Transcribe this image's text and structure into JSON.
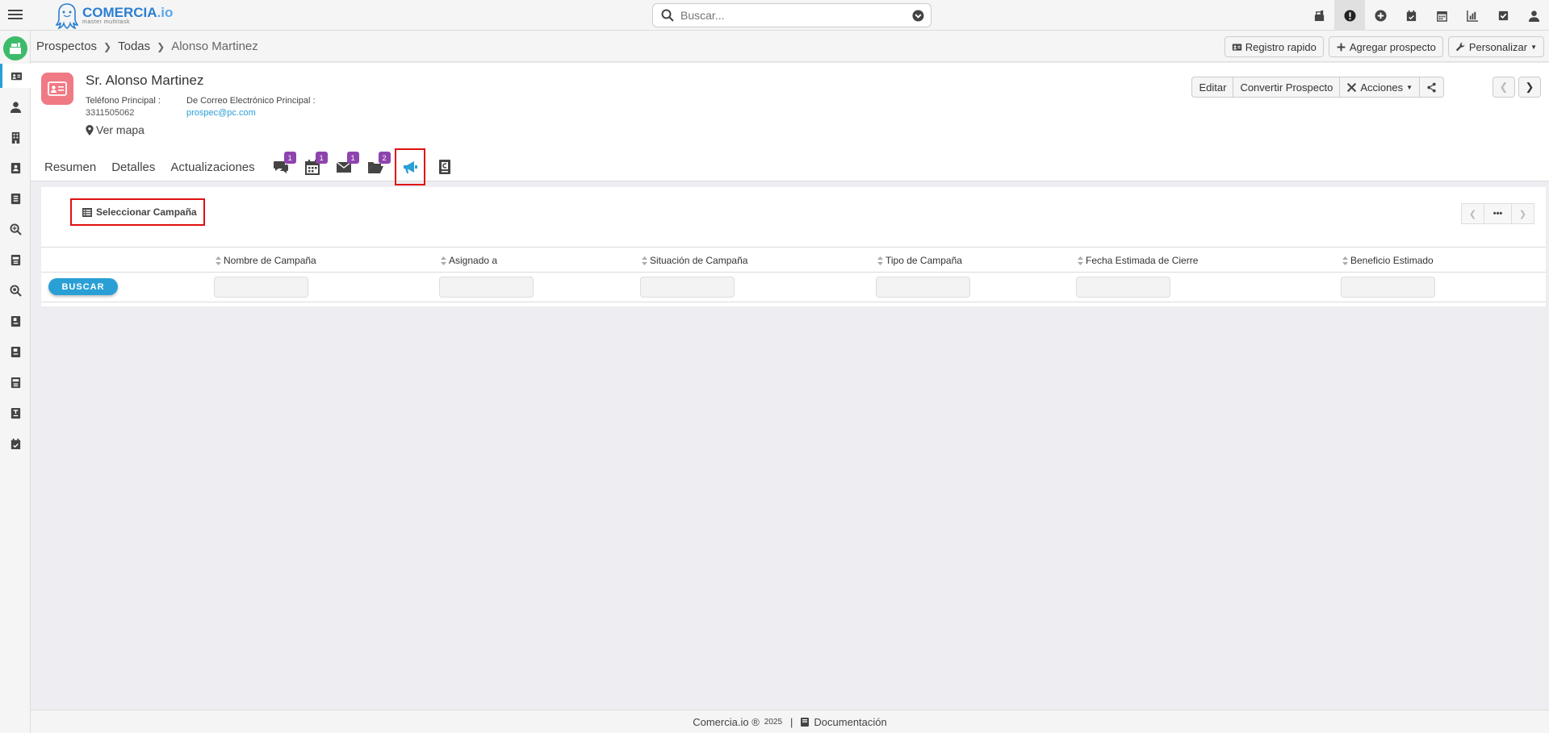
{
  "search": {
    "placeholder": "Buscar..."
  },
  "logo": {
    "brand": "COMERCIA",
    "suffix": ".io",
    "tagline": "master multitask"
  },
  "breadcrumb": {
    "items": [
      "Prospectos",
      "Todas",
      "Alonso Martinez"
    ]
  },
  "toolbar": {
    "registro_rapido": "Registro rapido",
    "agregar_prospecto": "Agregar prospecto",
    "personalizar": "Personalizar"
  },
  "record": {
    "title": "Sr. Alonso Martinez",
    "phone_label": "Teléfono Principal :",
    "phone_value": "3311505062",
    "email_label": "De Correo Electrónico Principal :",
    "email_value": "prospec@pc.com",
    "map_link": "Ver mapa"
  },
  "record_actions": {
    "editar": "Editar",
    "convertir": "Convertir Prospecto",
    "acciones": "Acciones"
  },
  "tabs": {
    "resumen": "Resumen",
    "detalles": "Detalles",
    "actualizaciones": "Actualizaciones",
    "badges": {
      "comments": "1",
      "calendar": "1",
      "emails": "1",
      "documents": "2"
    }
  },
  "campaigns": {
    "select_button": "Seleccionar Campaña",
    "columns": [
      "Nombre de Campaña",
      "Asignado a",
      "Situación de Campaña",
      "Tipo de Campaña",
      "Fecha Estimada de Cierre",
      "Beneficio Estimado"
    ],
    "search_button": "BUSCAR",
    "pager_more": "•••"
  },
  "footer": {
    "brand": "Comercia.io ®",
    "year": "2025",
    "separator": "|",
    "docs": "Documentación"
  },
  "colors": {
    "accent": "#2a9fd6",
    "badge": "#8e44ad",
    "highlight": "#e01010",
    "record_icon": "#f07a84",
    "app_icon": "#3dbb6a"
  }
}
